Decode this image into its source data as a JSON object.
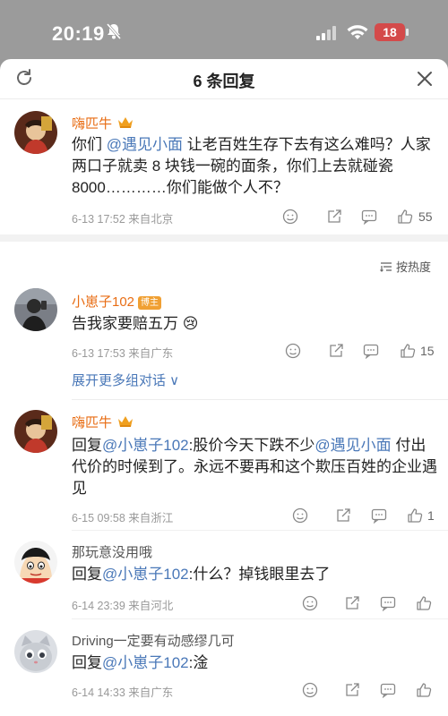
{
  "status": {
    "time": "20:19",
    "battery": "18"
  },
  "sheet": {
    "title": "6 条回复"
  },
  "main_comment": {
    "author": "嗨匹牛",
    "text_before": "你们 ",
    "mention": "@遇见小面",
    "text_after": " 让老百姓生存下去有这么难吗？人家两口子就卖 8 块钱一碗的面条，你们上去就碰瓷 8000…………你们能做个人不？",
    "meta": "6-13 17:52  来自北京",
    "likes": "55"
  },
  "sort_label": "按热度",
  "replies": [
    {
      "author": "小崽子102",
      "badge": "博主",
      "text": "告我家要赔五万 😢",
      "meta": "6-13 17:53  来自广东",
      "likes": "15",
      "expand_label": "展开更多组对话 ∨"
    },
    {
      "author": "嗨匹牛",
      "text_prefix": "回复",
      "mention1": "@小崽子102",
      "text_mid": ":股价今天下跌不少",
      "mention2": "@遇见小面",
      "text_after": " 付出代价的时候到了。永远不要再和这个欺压百姓的企业遇见",
      "meta": "6-15 09:58  来自浙江",
      "likes": "1"
    },
    {
      "author": "那玩意没用哦",
      "text_prefix": "回复",
      "mention1": "@小崽子102",
      "text_after": ":什么？掉钱眼里去了",
      "meta": "6-14 23:39  来自河北"
    },
    {
      "author": "Driving一定要有动感缪几可",
      "text_prefix": "回复",
      "mention1": "@小崽子102",
      "text_after": ":淦",
      "meta": "6-14 14:33  来自广东"
    }
  ],
  "colors": {
    "name_orange": "#e86d14",
    "mention_blue": "#4a78b8"
  },
  "icons": [
    "bell-slash-icon",
    "signal-icon",
    "wifi-icon",
    "refresh-icon",
    "close-icon",
    "crown-icon",
    "sort-icon",
    "emoji-icon",
    "share-icon",
    "comment-icon",
    "like-icon"
  ]
}
